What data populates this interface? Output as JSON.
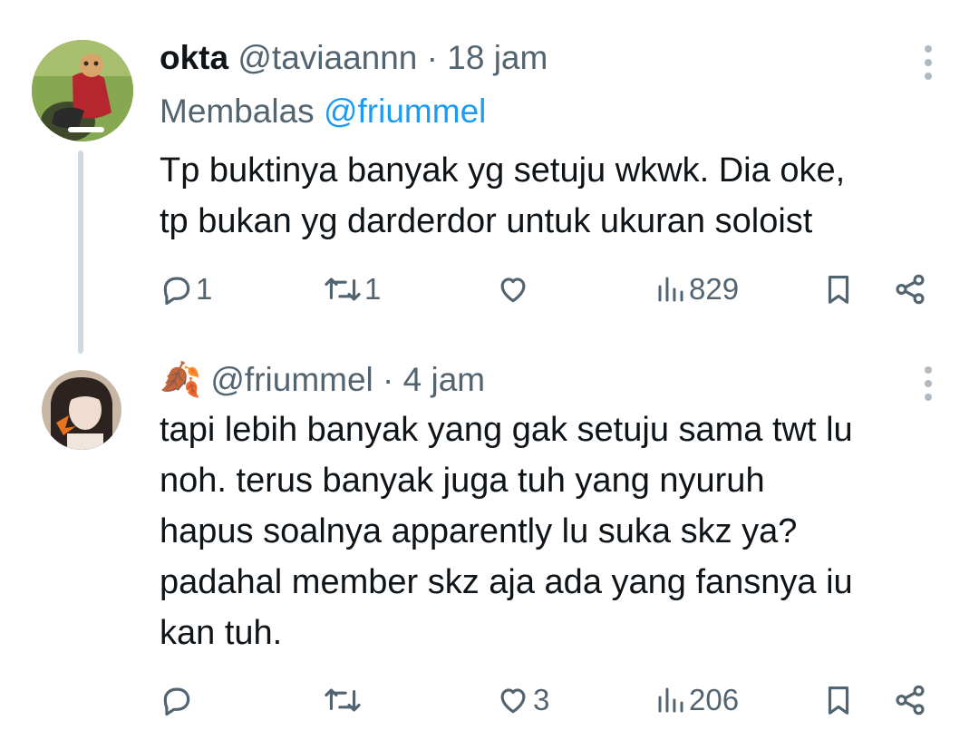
{
  "tweets": [
    {
      "display_name": "okta",
      "handle": "@taviaannn",
      "time": "18 jam",
      "replying_prefix": "Membalas",
      "replying_to": "@friummel",
      "text_lines": [
        "Tp buktinya banyak yg setuju wkwk. Dia oke,",
        "tp bukan yg darderdor untuk ukuran soloist"
      ],
      "replies": "1",
      "retweets": "1",
      "likes": "",
      "views": "829"
    },
    {
      "display_name_emoji": "🍂",
      "handle": "@friummel",
      "time": "4 jam",
      "text_lines": [
        "tapi lebih banyak yang gak setuju sama twt lu",
        "noh. terus banyak juga tuh yang nyuruh",
        "hapus soalnya apparently lu suka skz ya?",
        "padahal member skz aja ada yang fansnya iu",
        "kan tuh."
      ],
      "replies": "",
      "retweets": "",
      "likes": "3",
      "views": "206"
    }
  ],
  "separator": "·",
  "icons": {
    "reply": "reply-icon",
    "retweet": "retweet-icon",
    "like": "heart-icon",
    "views": "views-icon",
    "bookmark": "bookmark-icon",
    "share": "share-icon",
    "more": "more-icon"
  },
  "colors": {
    "text": "#0f1419",
    "secondary": "#536471",
    "accent": "#1d9bf0",
    "thread_line": "#cfd9de"
  }
}
